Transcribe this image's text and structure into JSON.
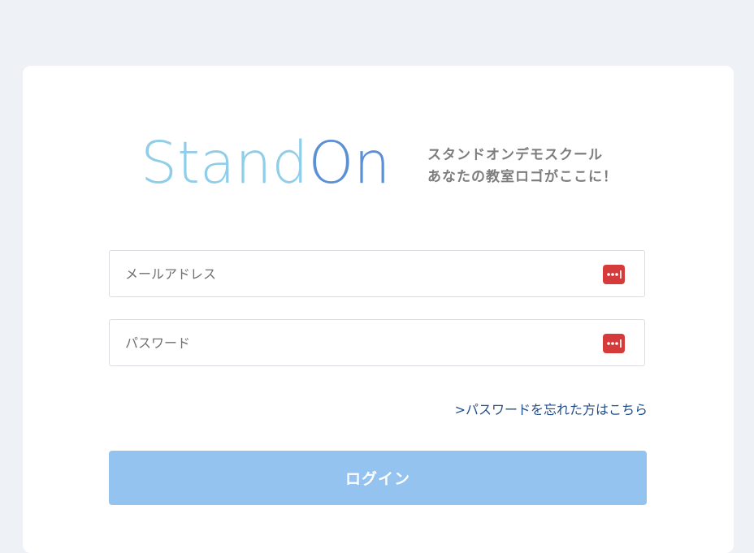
{
  "logo": {
    "word_part1": "Stand",
    "word_part2": "On",
    "tagline_line1": "スタンドオンデモスクール",
    "tagline_line2": "あなたの教室ロゴがここに！",
    "color_light": "#8fcde9",
    "color_dark": "#5b8fd6"
  },
  "form": {
    "email_placeholder": "メールアドレス",
    "email_value": "",
    "password_placeholder": "パスワード",
    "password_value": "",
    "forgot_link": ">パスワードを忘れた方はこちら",
    "login_button": "ログイン"
  },
  "icons": {
    "field_autofill": "password-manager-icon"
  },
  "colors": {
    "background": "#eef2f6",
    "card": "#ffffff",
    "button": "#94c3f0",
    "link": "#1f4e8c",
    "autofill_icon": "#d63b3b"
  }
}
